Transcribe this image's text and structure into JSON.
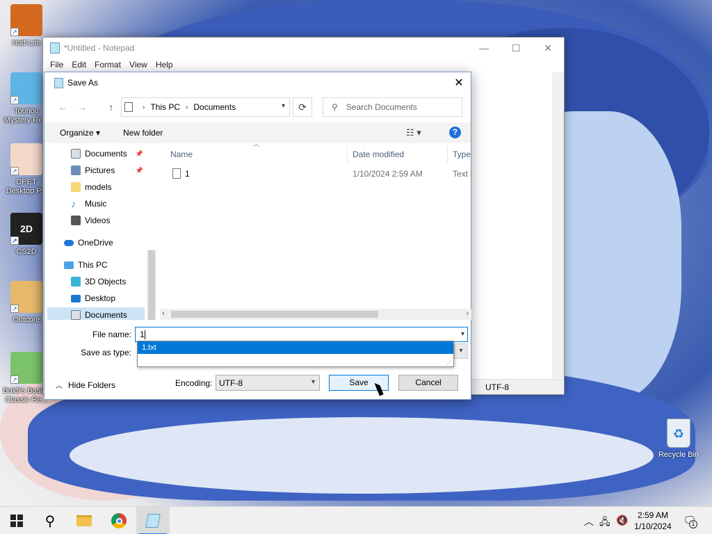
{
  "desktop": {
    "icons": [
      {
        "label": "Half-Life",
        "color": "#d2691e"
      },
      {
        "label": "Touhou Mystery Re...",
        "color": "#5fb4e6"
      },
      {
        "label": "DPET Desktop P...",
        "color": "#f4d8c8"
      },
      {
        "label": "CS2D",
        "color": "#222222"
      },
      {
        "label": "Outcore",
        "color": "#e6b86a"
      },
      {
        "label": "Baldi's Basics Classic Re...",
        "color": "#7bc36b"
      }
    ],
    "recycle_bin": "Recycle Bin"
  },
  "notepad": {
    "title": "*Untitled - Notepad",
    "menu": [
      "File",
      "Edit",
      "Format",
      "View",
      "Help"
    ],
    "status_encoding": "UTF-8"
  },
  "dialog": {
    "title": "Save As",
    "breadcrumb": [
      "This PC",
      "Documents"
    ],
    "search_placeholder": "Search Documents",
    "toolbar": {
      "organize": "Organize ▾",
      "new_folder": "New folder"
    },
    "nav_items": [
      {
        "label": "Documents",
        "icon": "documents-icon",
        "color": "#d7dfe8",
        "pinned": true
      },
      {
        "label": "Pictures",
        "icon": "pictures-icon",
        "color": "#6a8fb8",
        "pinned": true
      },
      {
        "label": "models",
        "icon": "folder-icon",
        "color": "#f7d674",
        "pinned": false
      },
      {
        "label": "Music",
        "icon": "music-icon",
        "color": "#2f7fd8",
        "pinned": false
      },
      {
        "label": "Videos",
        "icon": "videos-icon",
        "color": "#555555",
        "pinned": false
      },
      {
        "label": "OneDrive",
        "icon": "onedrive-icon",
        "color": "#1e78d6",
        "pinned": false
      },
      {
        "label": "This PC",
        "icon": "this-pc-icon",
        "color": "#4ea3e6",
        "pinned": false
      },
      {
        "label": "3D Objects",
        "icon": "3d-objects-icon",
        "color": "#39b3d9",
        "pinned": false
      },
      {
        "label": "Desktop",
        "icon": "desktop-icon",
        "color": "#1e78d6",
        "pinned": false
      },
      {
        "label": "Documents",
        "icon": "documents-icon",
        "color": "#d7dfe8",
        "pinned": false
      }
    ],
    "columns": [
      "Name",
      "Date modified",
      "Type"
    ],
    "files": [
      {
        "name": "1",
        "date": "1/10/2024 2:59 AM",
        "type": "Text Document"
      }
    ],
    "file_name_label": "File name:",
    "file_name_value": "1",
    "save_as_type_label": "Save as type:",
    "suggestion": "1.txt",
    "hide_folders": "Hide Folders",
    "encoding_label": "Encoding:",
    "encoding_value": "UTF-8",
    "save_label": "Save",
    "cancel_label": "Cancel"
  },
  "taskbar": {
    "time": "2:59 AM",
    "date": "1/10/2024",
    "notification_count": "1"
  }
}
